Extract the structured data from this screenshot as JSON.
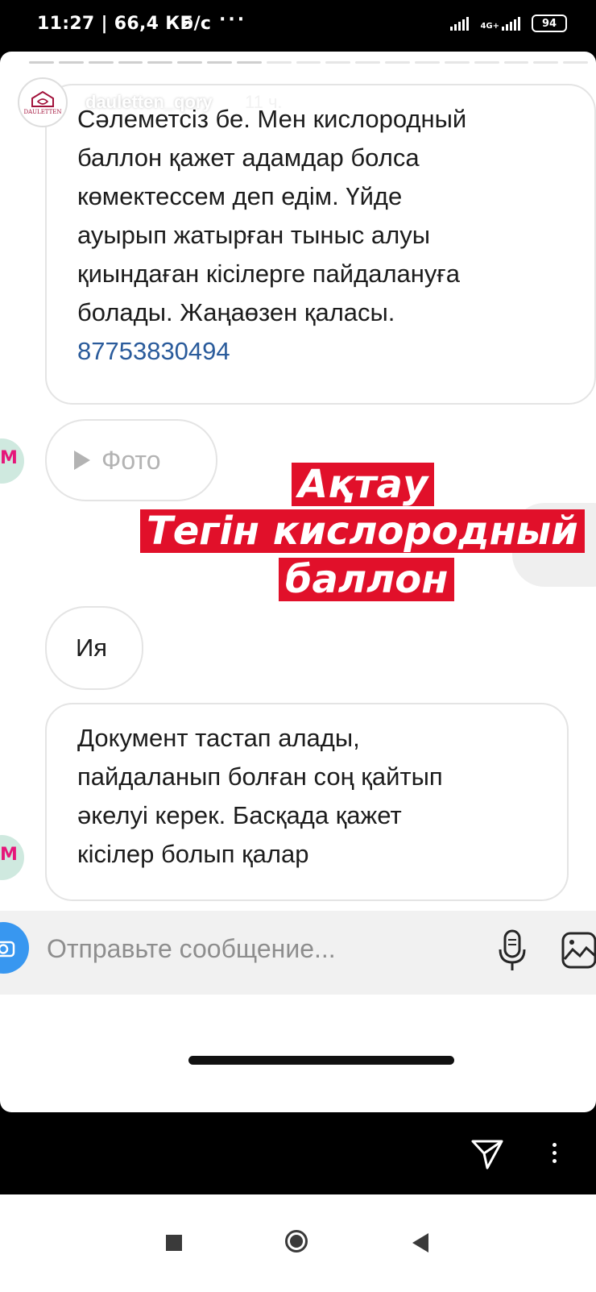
{
  "status_bar": {
    "time_speed": "11:27 | 66,4 КБ/с",
    "network": "4G+",
    "battery": "94"
  },
  "story": {
    "username": "dauletten_qory",
    "time_ago": "11 ч.",
    "brand": "DAULETTEN",
    "progress_segments": 19,
    "progress_done": 8
  },
  "messages": [
    {
      "lines": [
        "Сәлеметсіз бе. Мен кислородный",
        "баллон қажет адамдар болса",
        "көмектессем деп едім.  Үйде",
        "ауырып жатырған тыныс алуы",
        "қиындаған кісілерге пайдалануға",
        "болады.  Жаңаөзен қаласы."
      ],
      "phone": "87753830494"
    },
    {
      "label": "Фото"
    },
    {
      "text": "Ия"
    },
    {
      "lines": [
        "Документ тастап алады,",
        "пайдаланып болған соң қайтып",
        "әкелуі керек. Басқада қажет",
        "кісілер болып қалар"
      ]
    }
  ],
  "overlay": {
    "line1": "Ақтау",
    "line2": "Тегін кислородный",
    "line3": "баллон",
    "color": "#e1102a"
  },
  "composer": {
    "placeholder": "Отправьте сообщение..."
  },
  "icons": {
    "camera": "camera-icon",
    "mic": "microphone-icon",
    "gallery": "gallery-icon",
    "send": "send-icon",
    "more": "more-vertical-icon"
  }
}
